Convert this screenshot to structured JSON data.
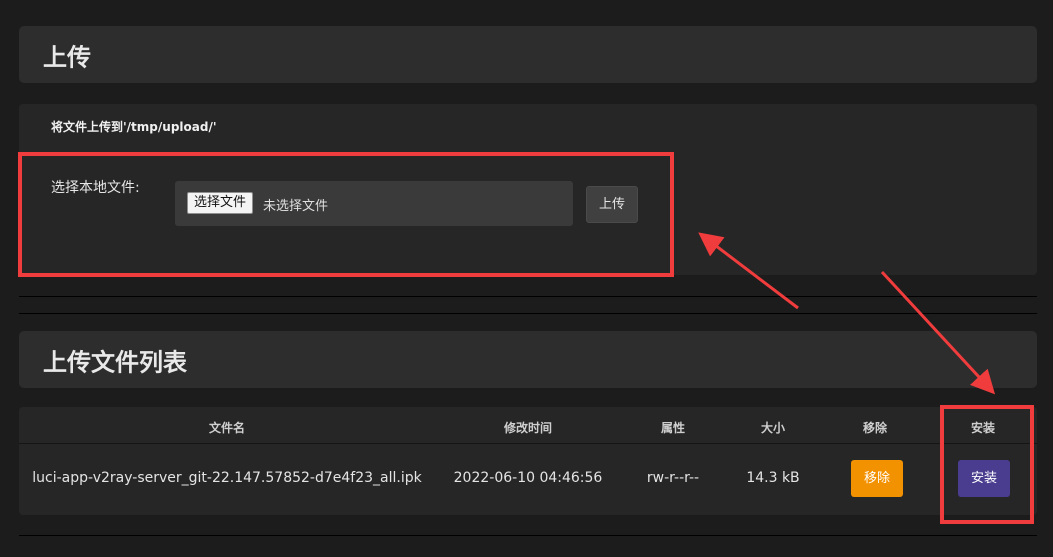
{
  "upload_section": {
    "title": "上传",
    "description": "将文件上传到'/tmp/upload/'",
    "field_label": "选择本地文件:",
    "choose_button": "选择文件",
    "no_file_text": "未选择文件",
    "upload_button": "上传"
  },
  "list_section": {
    "title": "上传文件列表",
    "columns": [
      "文件名",
      "修改时间",
      "属性",
      "大小",
      "移除",
      "安装"
    ],
    "rows": [
      {
        "filename": "luci-app-v2ray-server_git-22.147.57852-d7e4f23_all.ipk",
        "modified": "2022-06-10 04:46:56",
        "attributes": "rw-r--r--",
        "size": "14.3 kB",
        "remove_label": "移除",
        "install_label": "安装"
      }
    ]
  },
  "colors": {
    "remove_button": "#f39200",
    "install_button": "#4a3d8f",
    "annotation": "#f03c3c"
  }
}
